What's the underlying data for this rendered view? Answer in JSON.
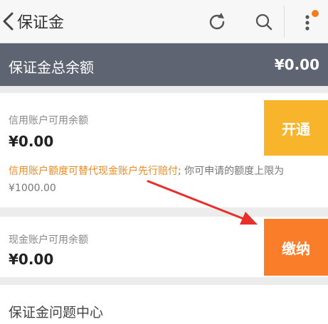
{
  "header": {
    "title": "保证金",
    "back_icon": "chevron-left-icon",
    "refresh_icon": "refresh-icon",
    "search_icon": "search-icon",
    "menu_icon": "more-vertical-icon",
    "notification_color": "#f57c1f"
  },
  "summary": {
    "label": "保证金总余额",
    "amount": "¥0.00",
    "background": "#5f6473"
  },
  "credit": {
    "label": "信用账户可用余额",
    "value": "¥0.00",
    "button_label": "开通",
    "button_color": "#f8b42b"
  },
  "notice": {
    "highlight": "信用账户额度可替代现金账户先行赔付",
    "rest": "; 你可申请的额度上限为¥1000.00"
  },
  "cash": {
    "label": "现金账户可用余额",
    "value": "¥0.00",
    "button_label": "缴纳",
    "button_color": "#fa7d29"
  },
  "faq": {
    "label": "保证金问题中心"
  }
}
